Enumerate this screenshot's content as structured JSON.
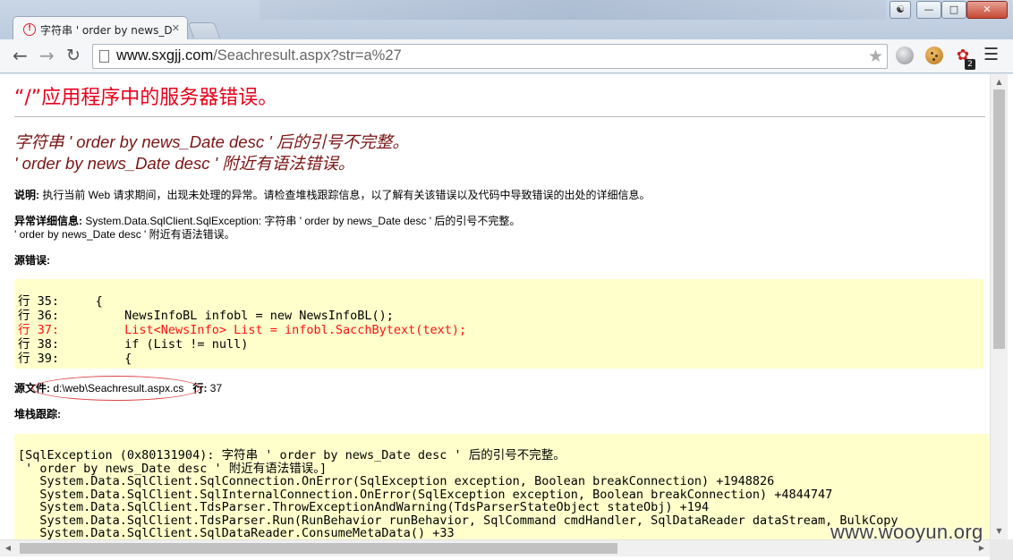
{
  "browser": {
    "tab_title": "字符串 ' order by news_D",
    "tab_close_glyph": "✕",
    "url_host": "www.sxgjj.com",
    "url_path": "/Seachresult.aspx?str=a%27",
    "extension_badge": "2"
  },
  "page": {
    "error_title": "“/”应用程序中的服务器错误。",
    "error_message_line1": "字符串 ' order by news_Date desc ' 后的引号不完整。",
    "error_message_line2": "' order by news_Date desc ' 附近有语法错误。",
    "description_label": "说明:",
    "description_text": " 执行当前 Web 请求期间，出现未处理的异常。请检查堆栈跟踪信息，以了解有关该错误以及代码中导致错误的出处的详细信息。",
    "exception_label": "异常详细信息:",
    "exception_text": " System.Data.SqlClient.SqlException: 字符串 ' order by news_Date desc ' 后的引号不完整。",
    "exception_text2": "' order by news_Date desc ' 附近有语法错误。",
    "source_error_label": "源错误:",
    "source_lines": [
      "行 35:     {",
      "行 36:         NewsInfoBL infobl = new NewsInfoBL();",
      "行 37:         List<NewsInfo> List = infobl.SacchBytext(text);",
      "行 38:         if (List != null)",
      "行 39:         {"
    ],
    "source_file_label": "源文件:",
    "source_file_path": " d:\\web\\Seachresult.aspx.cs",
    "line_label": "行:",
    "line_number": " 37",
    "stack_trace_label": "堆栈跟踪:",
    "stack_lines": [
      "[SqlException (0x80131904): 字符串 ' order by news_Date desc ' 后的引号不完整。",
      " ' order by news_Date desc ' 附近有语法错误。]",
      "   System.Data.SqlClient.SqlConnection.OnError(SqlException exception, Boolean breakConnection) +1948826",
      "   System.Data.SqlClient.SqlInternalConnection.OnError(SqlException exception, Boolean breakConnection) +4844747",
      "   System.Data.SqlClient.TdsParser.ThrowExceptionAndWarning(TdsParserStateObject stateObj) +194",
      "   System.Data.SqlClient.TdsParser.Run(RunBehavior runBehavior, SqlCommand cmdHandler, SqlDataReader dataStream, BulkCopy",
      "   System.Data.SqlClient.SqlDataReader.ConsumeMetaData() +33"
    ]
  },
  "watermark": "www.wooyun.org",
  "icons": {
    "back": "back-arrow-icon",
    "forward": "forward-arrow-icon",
    "reload": "reload-icon",
    "star": "bookmark-star-icon",
    "menu": "hamburger-menu-icon"
  },
  "colors": {
    "error_title": "#e8001a",
    "error_message": "#7a1414",
    "code_bg": "#ffffcc",
    "highlight_line": "#ff1010"
  }
}
